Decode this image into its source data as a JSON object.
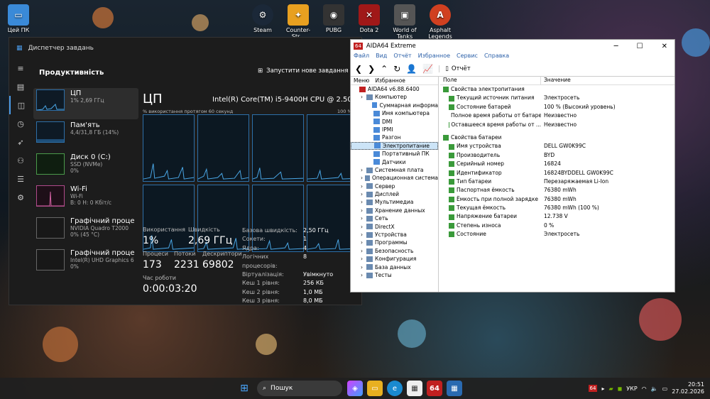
{
  "desktop": {
    "icons": [
      {
        "label": "Цей ПК"
      },
      {
        "label": "Steam"
      },
      {
        "label": "Counter-Str..."
      },
      {
        "label": "PUBG"
      },
      {
        "label": "Dota 2"
      },
      {
        "label": "World of Tanks"
      },
      {
        "label": "Asphalt Legends"
      }
    ]
  },
  "taskmgr": {
    "title": "Диспетчер завдань",
    "section": "Продуктивність",
    "new_task": "Запустити нове завдання",
    "items": [
      {
        "name": "ЦП",
        "sub": "1% 2,69 ГГц"
      },
      {
        "name": "Пам'ять",
        "sub": "4,4/31,8 ГБ (14%)"
      },
      {
        "name": "Диск 0 (C:)",
        "sub": "SSD (NVMe)",
        "sub2": "0%"
      },
      {
        "name": "Wi-Fi",
        "sub": "Wi-Fi",
        "sub2": "В: 0 Н: 0 Кбіт/с"
      },
      {
        "name": "Графічний проце",
        "sub": "NVIDIA Quadro T2000",
        "sub2": "0% (45 °C)"
      },
      {
        "name": "Графічний проце",
        "sub": "Intel(R) UHD Graphics 6",
        "sub2": "0%"
      }
    ],
    "cpu_title": "ЦП",
    "cpu_model": "Intel(R) Core(TM) i5-9400H CPU @ 2.50GHz",
    "graph_label": "% використання протягом 60 секунд",
    "graph_max": "100 %",
    "util_label": "Використання",
    "util": "1%",
    "speed_label": "Швидкість",
    "speed": "2,69 ГГц",
    "proc_label": "Процеси",
    "proc": "173",
    "thr_label": "Потоки",
    "thr": "2231",
    "desc_label": "Дескриптори",
    "desc": "69802",
    "up_label": "Час роботи",
    "up": "0:00:03:20",
    "specs": [
      {
        "k": "Базова швидкість:",
        "v": "2,50 ГГц"
      },
      {
        "k": "Сокети:",
        "v": "1"
      },
      {
        "k": "Ядра:",
        "v": "4"
      },
      {
        "k": "Логічних процесорів:",
        "v": "8"
      },
      {
        "k": "Віртуалізація:",
        "v": "Увімкнуто"
      },
      {
        "k": "Кеш 1 рівня:",
        "v": "256 КБ"
      },
      {
        "k": "Кеш 2 рівня:",
        "v": "1,0 МБ"
      },
      {
        "k": "Кеш 3 рівня:",
        "v": "8,0 МБ"
      }
    ]
  },
  "aida": {
    "title": "AIDA64 Extreme",
    "menu": [
      "Файл",
      "Вид",
      "Отчёт",
      "Избранное",
      "Сервис",
      "Справка"
    ],
    "report": "Отчёт",
    "tabs": [
      "Меню",
      "Избранное"
    ],
    "col_field": "Поле",
    "col_value": "Значение",
    "tree": [
      {
        "t": "AIDA64 v6.88.6400",
        "d": 0
      },
      {
        "t": "Компьютер",
        "d": 1
      },
      {
        "t": "Суммарная информа",
        "d": 2
      },
      {
        "t": "Имя компьютера",
        "d": 2
      },
      {
        "t": "DMI",
        "d": 2
      },
      {
        "t": "IPMI",
        "d": 2
      },
      {
        "t": "Разгон",
        "d": 2
      },
      {
        "t": "Электропитание",
        "d": 2,
        "sel": true
      },
      {
        "t": "Портативный ПК",
        "d": 2
      },
      {
        "t": "Датчики",
        "d": 2
      },
      {
        "t": "Системная плата",
        "d": 1
      },
      {
        "t": "Операционная система",
        "d": 1
      },
      {
        "t": "Сервер",
        "d": 1
      },
      {
        "t": "Дисплей",
        "d": 1
      },
      {
        "t": "Мультимедиа",
        "d": 1
      },
      {
        "t": "Хранение данных",
        "d": 1
      },
      {
        "t": "Сеть",
        "d": 1
      },
      {
        "t": "DirectX",
        "d": 1
      },
      {
        "t": "Устройства",
        "d": 1
      },
      {
        "t": "Программы",
        "d": 1
      },
      {
        "t": "Безопасность",
        "d": 1
      },
      {
        "t": "Конфигурация",
        "d": 1
      },
      {
        "t": "База данных",
        "d": 1
      },
      {
        "t": "Тесты",
        "d": 1
      }
    ],
    "sec1": "Свойства электропитания",
    "rows1": [
      {
        "k": "Текущий источник питания",
        "v": "Электросеть"
      },
      {
        "k": "Состояние батарей",
        "v": "100 % (Высокий уровень)"
      },
      {
        "k": "Полное время работы от батаре...",
        "v": "Неизвестно"
      },
      {
        "k": "Оставшееся время работы от ...",
        "v": "Неизвестно"
      }
    ],
    "sec2": "Свойства батареи",
    "rows2": [
      {
        "k": "Имя устройства",
        "v": "DELL GW0K99C"
      },
      {
        "k": "Производитель",
        "v": "BYD"
      },
      {
        "k": "Серийный номер",
        "v": "16824"
      },
      {
        "k": "Идентификатор",
        "v": "16824BYDDELL GW0K99C"
      },
      {
        "k": "Тип батареи",
        "v": "Перезаряжаемая Li-Ion"
      },
      {
        "k": "Паспортная ёмкость",
        "v": "76380 mWh"
      },
      {
        "k": "Ёмкость при полной зарядке",
        "v": "76380 mWh"
      },
      {
        "k": "Текущая ёмкость",
        "v": "76380 mWh  (100 %)"
      },
      {
        "k": "Напряжение батареи",
        "v": "12.738 V"
      },
      {
        "k": "Степень износа",
        "v": "0 %"
      },
      {
        "k": "Состояние",
        "v": "Электросеть"
      }
    ]
  },
  "taskbar": {
    "search": "Пошук",
    "lang": "УКР",
    "time": "20:51",
    "date": "27.02.2026",
    "aida_badge": "64"
  }
}
